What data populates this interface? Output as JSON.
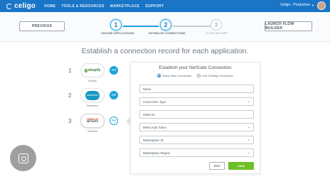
{
  "nav": {
    "brand": "celigo",
    "links": [
      "HOME",
      "TOOLS & RESOURCES",
      "MARKETPLACE",
      "SUPPORT"
    ],
    "account": "Celigo : Productive"
  },
  "stepbar": {
    "previous_label": "PREVIOUS",
    "launch_label": "LAUNCH FLOW BUILDER",
    "steps": [
      {
        "number": "1",
        "label": "CHOOSE APPLICATIONS"
      },
      {
        "number": "2",
        "label": "ESTABLISH CONNECTIONS"
      },
      {
        "number": "3",
        "label": "FLOW BUILDER"
      }
    ]
  },
  "headline": "Establish a connection record for each application.",
  "apps": [
    {
      "number": "1",
      "name": "Shopify",
      "logo_text": "shopify"
    },
    {
      "number": "2",
      "name": "Salesforce",
      "logo_text": "salesforce"
    },
    {
      "number": "3",
      "name": "NetSuite",
      "logo_line1": "ORACLE",
      "logo_line2": "NETSUITE"
    }
  ],
  "form": {
    "title": "Establish your NetSuite Connection",
    "radio_new": "Setup New Connection",
    "radio_existing": "Use Existing Connection",
    "fields": {
      "name": "Name",
      "connection_type": "Connection Type",
      "seller_id": "Seller ID",
      "mws_token": "MWS Auth Token",
      "marketplace_id": "Marketplace ID",
      "marketplace_region": "Marketplace Region"
    },
    "test_label": "TEST",
    "save_label": "SAVE"
  },
  "colors": {
    "nav": "#1a75c7",
    "accent": "#1aa3d9",
    "save": "#6fbf26"
  }
}
